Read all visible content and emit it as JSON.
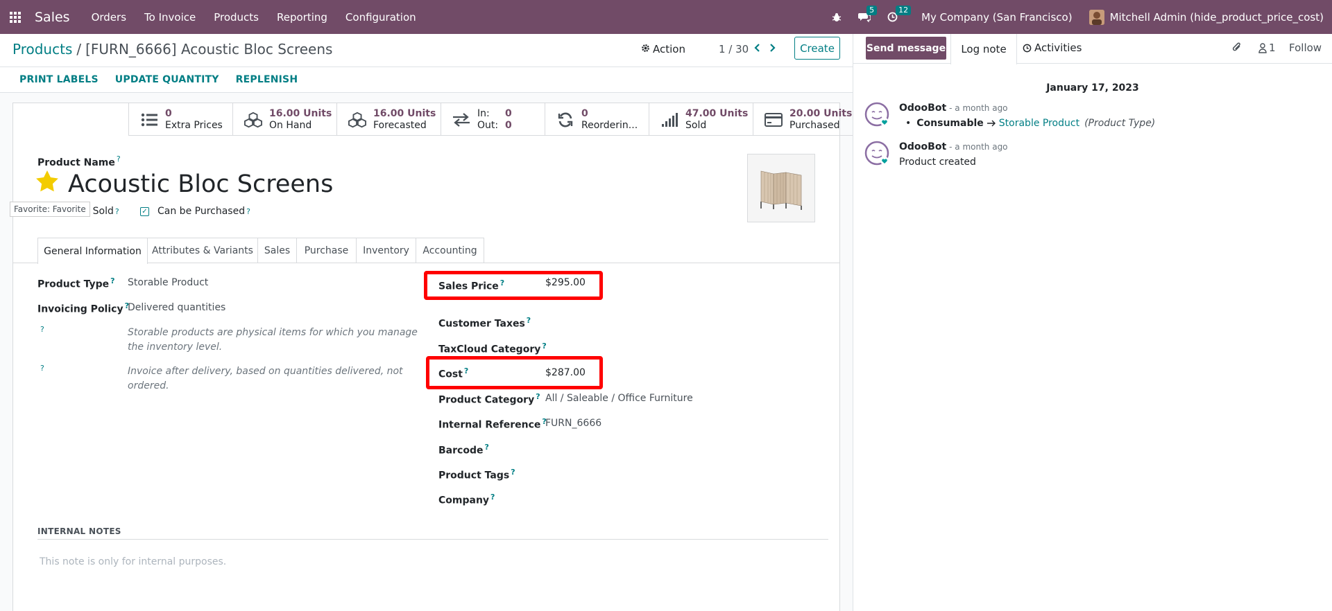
{
  "navbar": {
    "app_name": "Sales",
    "menu": [
      "Orders",
      "To Invoice",
      "Products",
      "Reporting",
      "Configuration"
    ],
    "messages_count": "5",
    "activities_count": "12",
    "company": "My Company (San Francisco)",
    "user": "Mitchell Admin (hide_product_price_cost)"
  },
  "control": {
    "breadcrumb_parent": "Products",
    "breadcrumb_sep": "/",
    "breadcrumb_current": "[FURN_6666] Acoustic Bloc Screens",
    "action_label": "Action",
    "pager": "1 / 30",
    "create_label": "Create"
  },
  "actionbar": {
    "buttons": [
      "PRINT LABELS",
      "UPDATE QUANTITY",
      "REPLENISH"
    ]
  },
  "smart_buttons": [
    {
      "icon": "list-icon",
      "value": "0",
      "label": "Extra Prices"
    },
    {
      "icon": "cubes-icon",
      "value": "16.00 Units",
      "label": "On Hand"
    },
    {
      "icon": "cubes-icon",
      "value": "16.00 Units",
      "label": "Forecasted"
    },
    {
      "icon": "exchange-icon",
      "in_label": "In:",
      "in_value": "0",
      "out_label": "Out:",
      "out_value": "0"
    },
    {
      "icon": "refresh-icon",
      "value": "0",
      "label": "Reorderin..."
    },
    {
      "icon": "signal-icon",
      "value": "47.00 Units",
      "label": "Sold"
    },
    {
      "icon": "credit-card-icon",
      "value": "20.00 Units",
      "label": "Purchased"
    }
  ],
  "product": {
    "name_label": "Product Name",
    "name": "Acoustic Bloc Screens",
    "favorite_tooltip": "Favorite: Favorite",
    "can_be_sold_label": "Can be Sold",
    "can_be_purchased_label": "Can be Purchased",
    "help_mark": "?"
  },
  "tabs": [
    "General Information",
    "Attributes & Variants",
    "Sales",
    "Purchase",
    "Inventory",
    "Accounting"
  ],
  "general": {
    "product_type_label": "Product Type",
    "product_type": "Storable Product",
    "invoicing_policy_label": "Invoicing Policy",
    "invoicing_policy": "Delivered quantities",
    "note_type": "Storable products are physical items for which you manage the inventory level.",
    "note_invoice": "Invoice after delivery, based on quantities delivered, not ordered.",
    "sales_price_label": "Sales Price",
    "sales_price": "$295.00",
    "customer_taxes_label": "Customer Taxes",
    "taxcloud_label": "TaxCloud Category",
    "cost_label": "Cost",
    "cost": "$287.00",
    "category_label": "Product Category",
    "category": "All / Saleable / Office Furniture",
    "internal_ref_label": "Internal Reference",
    "internal_ref": "FURN_6666",
    "barcode_label": "Barcode",
    "tags_label": "Product Tags",
    "company_label": "Company"
  },
  "notes": {
    "heading": "INTERNAL NOTES",
    "placeholder": "This note is only for internal purposes."
  },
  "chatter": {
    "send_message": "Send message",
    "log_note": "Log note",
    "activities": "Activities",
    "followers_count": "1",
    "follow": "Follow",
    "date": "January 17, 2023",
    "messages": [
      {
        "author": "OdooBot",
        "date": "- a month ago",
        "old_value": "Consumable",
        "new_value": "Storable Product",
        "field": "(Product Type)"
      },
      {
        "author": "OdooBot",
        "date": "- a month ago",
        "body": "Product created"
      }
    ]
  },
  "colors": {
    "brand": "#714b67",
    "accent": "#017e84",
    "highlight": "#ff0000",
    "star": "#f3cc00"
  }
}
